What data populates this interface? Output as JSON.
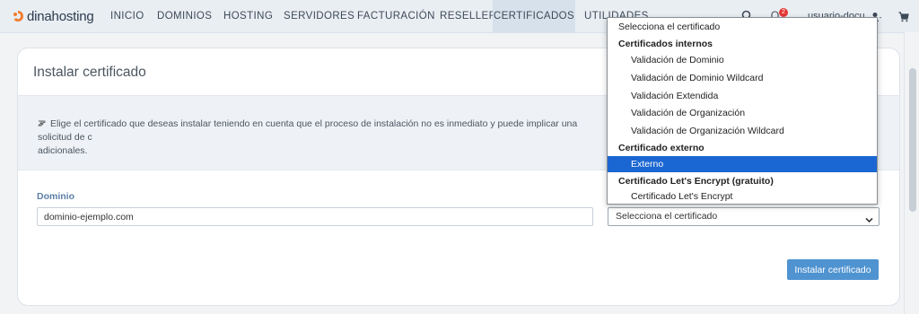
{
  "brand": {
    "name": "dinahosting",
    "color": "#f07d2e"
  },
  "nav": {
    "items": [
      {
        "label": "INICIO"
      },
      {
        "label": "DOMINIOS"
      },
      {
        "label": "HOSTING"
      },
      {
        "label": "SERVIDORES"
      },
      {
        "label": "FACTURACIÓN"
      },
      {
        "label": "RESELLER"
      },
      {
        "label": "CERTIFICADOS",
        "active": true
      },
      {
        "label": "UTILIDADES"
      }
    ],
    "notification_count": "2",
    "user": "usuario-docu",
    "icons": [
      "search-icon",
      "bell-icon",
      "user-icon",
      "cart-icon"
    ]
  },
  "page": {
    "title": "Instalar certificado",
    "info": "Elige el certificado que deseas instalar teniendo en cuenta que el proceso de instalación no es inmediato y puede implicar una solicitud de c",
    "info_line2": "adicionales.",
    "domain_label": "Dominio",
    "domain_value": "dominio-ejemplo.com",
    "select_value": "Selecciona el certificado",
    "install_button": "Instalar certificado"
  },
  "dropdown": {
    "placeholder": "Selecciona el certificado",
    "groups": [
      {
        "label": "Certificados internos",
        "options": [
          "Validación de Dominio",
          "Validación de Dominio Wildcard",
          "Validación Extendida",
          "Validación de Organización",
          "Validación de Organización Wildcard"
        ]
      },
      {
        "label": "Certificado externo",
        "options": [
          "Externo"
        ]
      },
      {
        "label": "Certificado Let's Encrypt (gratuito)",
        "options": [
          "Certificado Let's Encrypt"
        ]
      }
    ],
    "highlighted": "Externo"
  },
  "colors": {
    "accent": "#4f93d0",
    "highlight": "#1a66d2",
    "label": "#5a7fa6"
  }
}
